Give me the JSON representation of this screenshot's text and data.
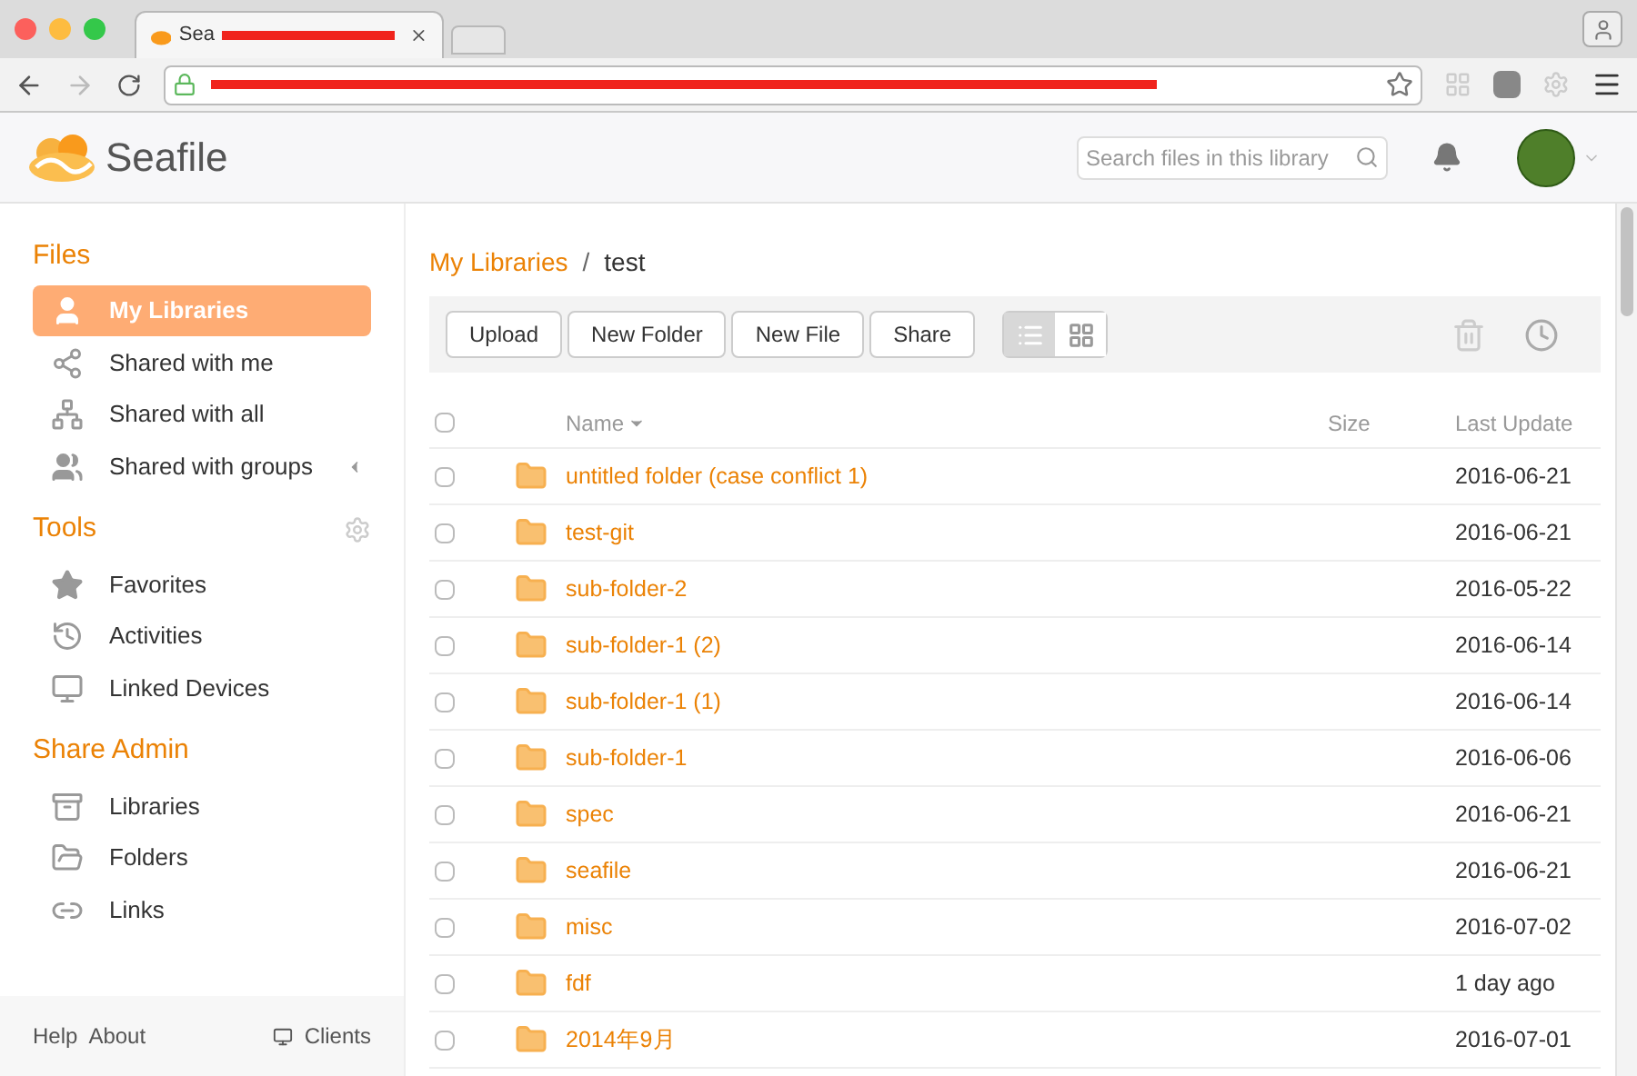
{
  "browser": {
    "tab_title": "Sea"
  },
  "header": {
    "logo": "Seafile",
    "search": {
      "placeholder": "Search files in this library"
    }
  },
  "sidebar": {
    "sections": [
      {
        "title": "Files",
        "has_gear": false,
        "items": [
          {
            "label": "My Libraries",
            "selected": true,
            "caret": false
          },
          {
            "label": "Shared with me",
            "selected": false,
            "caret": false
          },
          {
            "label": "Shared with all",
            "selected": false,
            "caret": false
          },
          {
            "label": "Shared with groups",
            "selected": false,
            "caret": true
          }
        ]
      },
      {
        "title": "Tools",
        "has_gear": true,
        "items": [
          {
            "label": "Favorites",
            "selected": false,
            "caret": false
          },
          {
            "label": "Activities",
            "selected": false,
            "caret": false
          },
          {
            "label": "Linked Devices",
            "selected": false,
            "caret": false
          }
        ]
      },
      {
        "title": "Share Admin",
        "has_gear": false,
        "items": [
          {
            "label": "Libraries",
            "selected": false,
            "caret": false
          },
          {
            "label": "Folders",
            "selected": false,
            "caret": false
          },
          {
            "label": "Links",
            "selected": false,
            "caret": false
          }
        ]
      }
    ],
    "footer": {
      "links": [
        "Help",
        "About"
      ],
      "clients": "Clients"
    }
  },
  "breadcrumb": {
    "root": "My Libraries",
    "separator": "/",
    "current": "test"
  },
  "toolbar": {
    "buttons": [
      "Upload",
      "New Folder",
      "New File",
      "Share"
    ],
    "views": [
      {
        "kind": "list",
        "selected": true
      },
      {
        "kind": "grid",
        "selected": false
      }
    ]
  },
  "table": {
    "all_checked": false,
    "columns": [
      "Name",
      "Size",
      "Last Update"
    ],
    "rows": [
      {
        "name": "untitled folder (case conflict 1)",
        "updated": "2016-06-21",
        "checked": false
      },
      {
        "name": "test-git",
        "updated": "2016-06-21",
        "checked": false
      },
      {
        "name": "sub-folder-2",
        "updated": "2016-05-22",
        "checked": false
      },
      {
        "name": "sub-folder-1 (2)",
        "updated": "2016-06-14",
        "checked": false
      },
      {
        "name": "sub-folder-1 (1)",
        "updated": "2016-06-14",
        "checked": false
      },
      {
        "name": "sub-folder-1",
        "updated": "2016-06-06",
        "checked": false
      },
      {
        "name": "spec",
        "updated": "2016-06-21",
        "checked": false
      },
      {
        "name": "seafile",
        "updated": "2016-06-21",
        "checked": false
      },
      {
        "name": "misc",
        "updated": "2016-07-02",
        "checked": false
      },
      {
        "name": "fdf",
        "updated": "1 day ago",
        "checked": false
      },
      {
        "name": "2014年9月",
        "updated": "2016-07-01",
        "checked": false
      }
    ]
  }
}
